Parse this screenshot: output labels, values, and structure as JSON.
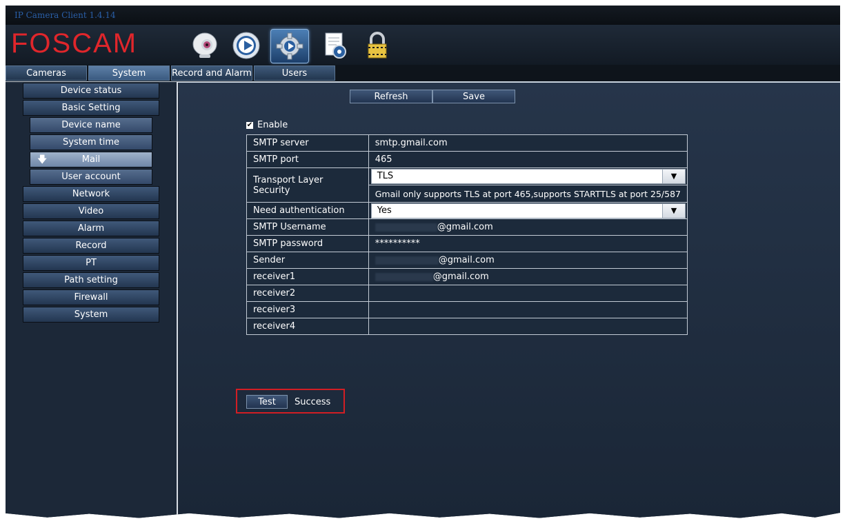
{
  "app": {
    "title": "IP Camera Client 1.4.14",
    "logo": "FOSCAM"
  },
  "toolbar": {
    "icons": [
      "webcam-icon",
      "playback-icon",
      "settings-gear-icon",
      "log-document-icon",
      "lock-icon"
    ]
  },
  "top_tabs": [
    {
      "label": "Cameras"
    },
    {
      "label": "System"
    },
    {
      "label": "Record and Alarm"
    },
    {
      "label": "Users"
    }
  ],
  "sidebar": {
    "items": [
      {
        "label": "Device status"
      },
      {
        "label": "Basic Setting"
      },
      {
        "label": "Device name"
      },
      {
        "label": "System time"
      },
      {
        "label": "Mail"
      },
      {
        "label": "User account"
      },
      {
        "label": "Network"
      },
      {
        "label": "Video"
      },
      {
        "label": "Alarm"
      },
      {
        "label": "Record"
      },
      {
        "label": "PT"
      },
      {
        "label": "Path setting"
      },
      {
        "label": "Firewall"
      },
      {
        "label": "System"
      }
    ]
  },
  "actions": {
    "refresh": "Refresh",
    "save": "Save"
  },
  "mail": {
    "enable_label": "Enable",
    "enable_checked": true,
    "rows": {
      "smtp_server": {
        "label": "SMTP server",
        "value": "smtp.gmail.com"
      },
      "smtp_port": {
        "label": "SMTP port",
        "value": "465"
      },
      "tls": {
        "label": "Transport Layer Security",
        "value": "TLS",
        "note": "Gmail only supports TLS at port 465,supports STARTTLS at port 25/587"
      },
      "auth": {
        "label": "Need authentication",
        "value": "Yes"
      },
      "username": {
        "label": "SMTP Username",
        "value": "@gmail.com"
      },
      "password": {
        "label": "SMTP password",
        "value": "**********"
      },
      "sender": {
        "label": "Sender",
        "value": "@gmail.com"
      },
      "receiver1": {
        "label": "receiver1",
        "value": "@gmail.com"
      },
      "receiver2": {
        "label": "receiver2",
        "value": ""
      },
      "receiver3": {
        "label": "receiver3",
        "value": ""
      },
      "receiver4": {
        "label": "receiver4",
        "value": ""
      }
    }
  },
  "test": {
    "button": "Test",
    "result": "Success"
  },
  "colors": {
    "accent_red": "#e0262b",
    "highlight_box": "#d31e24",
    "panel_bg": "#1b2533"
  }
}
